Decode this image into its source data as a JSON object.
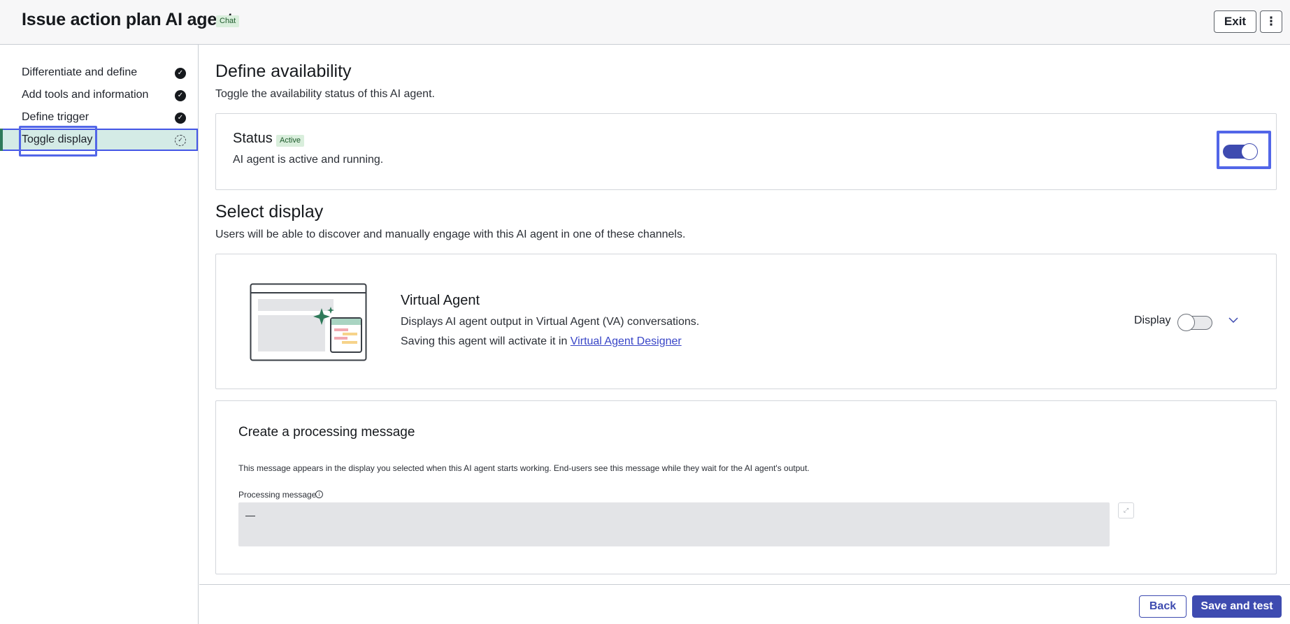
{
  "header": {
    "title": "Issue action plan AI agent",
    "badge": "Chat",
    "exit_label": "Exit",
    "more_icon": "⋮"
  },
  "sidebar": {
    "items": [
      {
        "label": "Differentiate and define",
        "state": "complete"
      },
      {
        "label": "Add tools and information",
        "state": "complete"
      },
      {
        "label": "Define trigger",
        "state": "complete"
      },
      {
        "label": "Toggle display",
        "state": "in-progress"
      }
    ]
  },
  "availability": {
    "heading": "Define availability",
    "description": "Toggle the availability status of this AI agent.",
    "status_title": "Status",
    "status_badge": "Active",
    "status_description": "AI agent is active and running.",
    "toggle_on": true
  },
  "display": {
    "heading": "Select display",
    "description": "Users will be able to discover and manually engage with this AI agent in one of these channels.",
    "channel": {
      "title": "Virtual Agent",
      "line1": "Displays AI agent output in Virtual Agent (VA) conversations.",
      "line2_prefix": "Saving this agent will activate it in ",
      "link": "Virtual Agent Designer",
      "display_label": "Display",
      "toggle_on": false
    }
  },
  "processing": {
    "title": "Create a processing message",
    "description": "This message appears in the display you selected when this AI agent starts working. End-users see this message while they wait for the AI agent's output.",
    "field_label": "Processing message",
    "field_value": "—"
  },
  "footer": {
    "back_label": "Back",
    "save_label": "Save and test"
  },
  "colors": {
    "accent": "#3e4bb0",
    "focus_ring": "#5266e8",
    "badge_bg": "#d9eedc",
    "active_nav_bg": "#d4ebe6"
  }
}
